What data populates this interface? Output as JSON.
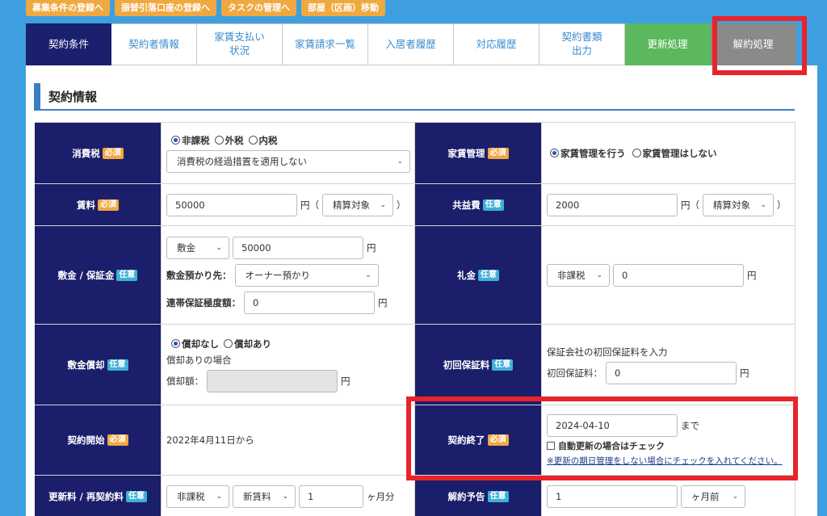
{
  "top_buttons": [
    "募集条件の登録へ",
    "振替引落口座の登録へ",
    "タスクの管理へ",
    "部屋（区画）移動"
  ],
  "tabs": [
    "契約条件",
    "契約者情報",
    "家賃支払い\n状況",
    "家賃請求一覧",
    "入居者履歴",
    "対応履歴",
    "契約書類\n出力",
    "更新処理",
    "解約処理"
  ],
  "section_title": "契約情報",
  "badges": {
    "required": "必須",
    "optional": "任意"
  },
  "fields": {
    "tax": {
      "label": "消費税",
      "options": [
        "非課税",
        "外税",
        "内税"
      ],
      "select": "消費税の経過措置を適用しない"
    },
    "rent_mgmt": {
      "label": "家賃管理",
      "options": [
        "家賃管理を行う",
        "家賃管理はしない"
      ]
    },
    "rent": {
      "label": "賃料",
      "value": "50000",
      "unit": "円（",
      "select": "精算対象",
      "close": "）"
    },
    "common": {
      "label": "共益費",
      "value": "2000",
      "unit": "円（",
      "select": "精算対象",
      "close": "）"
    },
    "deposit": {
      "label": "敷金 / 保証金",
      "type": "敷金",
      "value": "50000",
      "unit": "円",
      "holder_label": "敷金預かり先：",
      "holder": "オーナー預かり",
      "limit_label": "連帯保証極度額：",
      "limit": "0",
      "limit_unit": "円"
    },
    "key_money": {
      "label": "礼金",
      "tax": "非課税",
      "value": "0",
      "unit": "円"
    },
    "amort": {
      "label": "敷金償却",
      "options": [
        "償却なし",
        "償却あり"
      ],
      "note": "償却ありの場合",
      "amount_label": "償却額：",
      "amount": "",
      "unit": "円"
    },
    "guarantee": {
      "label": "初回保証料",
      "note": "保証会社の初回保証料を入力",
      "amount_label": "初回保証料：",
      "amount": "0",
      "unit": "円"
    },
    "start": {
      "label": "契約開始",
      "text": "2022年4月11日から"
    },
    "end": {
      "label": "契約終了",
      "date": "2024-04-10",
      "suffix": "まで",
      "checkbox": "自動更新の場合はチェック",
      "link": "※更新の期日管理をしない場合にチェックを入れてください。"
    },
    "renewal": {
      "label": "更新料 / 再契約料",
      "tax": "非課税",
      "base": "新賃料",
      "months": "1",
      "unit": "ヶ月分"
    },
    "notice": {
      "label": "解約予告",
      "value": "1",
      "select": "ヶ月前"
    }
  }
}
